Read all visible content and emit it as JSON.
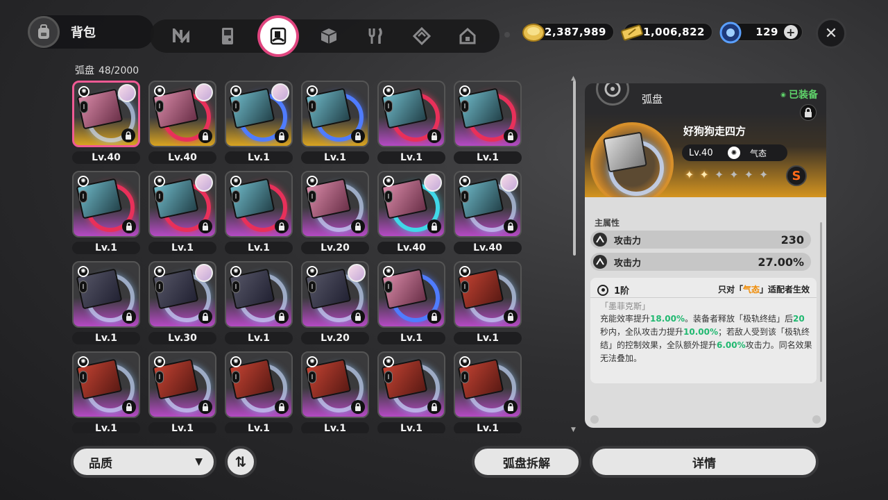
{
  "header": {
    "title": "背包",
    "tabs": [
      "n-icon",
      "gameboy-icon",
      "disk-icon",
      "cube-icon",
      "utensils-icon",
      "gem-icon",
      "home-icon"
    ],
    "active_tab_index": 2
  },
  "currencies": [
    {
      "icon": "coin-icon",
      "value": "2,387,989",
      "color": "#e8c050"
    },
    {
      "icon": "ticket-icon",
      "value": "1,006,822",
      "color": "#f0c858"
    },
    {
      "icon": "polychrome-icon",
      "value": "129",
      "color": "#5aa0ff"
    }
  ],
  "inventory": {
    "label": "弧盘",
    "count": "48/2000"
  },
  "items": [
    {
      "level": "Lv.40",
      "quality": "gold",
      "ring": "white",
      "art": "pink",
      "avatar": true,
      "selected": true
    },
    {
      "level": "Lv.40",
      "quality": "gold",
      "ring": "red",
      "art": "pink",
      "avatar": true
    },
    {
      "level": "Lv.1",
      "quality": "gold",
      "ring": "blue",
      "art": "teal",
      "avatar": true
    },
    {
      "level": "Lv.1",
      "quality": "gold",
      "ring": "blue",
      "art": "teal",
      "avatar": false
    },
    {
      "level": "Lv.1",
      "quality": "purple",
      "ring": "red",
      "art": "teal",
      "avatar": false
    },
    {
      "level": "Lv.1",
      "quality": "purple",
      "ring": "red",
      "art": "teal",
      "avatar": false
    },
    {
      "level": "Lv.1",
      "quality": "purple",
      "ring": "red",
      "art": "teal",
      "avatar": false
    },
    {
      "level": "Lv.1",
      "quality": "purple",
      "ring": "red",
      "art": "teal",
      "avatar": true
    },
    {
      "level": "Lv.1",
      "quality": "purple",
      "ring": "red",
      "art": "teal",
      "avatar": false
    },
    {
      "level": "Lv.20",
      "quality": "purple",
      "ring": "white",
      "art": "pink",
      "avatar": false
    },
    {
      "level": "Lv.40",
      "quality": "purple",
      "ring": "cyan",
      "art": "pink",
      "avatar": true
    },
    {
      "level": "Lv.40",
      "quality": "purple",
      "ring": "white",
      "art": "teal",
      "avatar": true
    },
    {
      "level": "Lv.1",
      "quality": "purple",
      "ring": "white",
      "art": "none",
      "avatar": false
    },
    {
      "level": "Lv.30",
      "quality": "purple",
      "ring": "white",
      "art": "none",
      "avatar": true
    },
    {
      "level": "Lv.1",
      "quality": "purple",
      "ring": "white",
      "art": "none",
      "avatar": false
    },
    {
      "level": "Lv.20",
      "quality": "purple",
      "ring": "white",
      "art": "none",
      "avatar": true
    },
    {
      "level": "Lv.1",
      "quality": "purple",
      "ring": "blue",
      "art": "pink",
      "avatar": false
    },
    {
      "level": "Lv.1",
      "quality": "purple",
      "ring": "white",
      "art": "red",
      "avatar": false
    },
    {
      "level": "Lv.1",
      "quality": "purple",
      "ring": "white",
      "art": "red",
      "avatar": false
    },
    {
      "level": "Lv.1",
      "quality": "purple",
      "ring": "white",
      "art": "red",
      "avatar": false
    },
    {
      "level": "Lv.1",
      "quality": "purple",
      "ring": "white",
      "art": "red",
      "avatar": false
    },
    {
      "level": "Lv.1",
      "quality": "purple",
      "ring": "white",
      "art": "red",
      "avatar": false
    },
    {
      "level": "Lv.1",
      "quality": "purple",
      "ring": "white",
      "art": "red",
      "avatar": false
    },
    {
      "level": "Lv.1",
      "quality": "purple",
      "ring": "white",
      "art": "red",
      "avatar": false
    }
  ],
  "rank_label": "I",
  "detail": {
    "category": "弧盘",
    "equipped_label": "已装备",
    "name": "好狗狗走四方",
    "level": "Lv.40",
    "attribute": "气态",
    "stars_total": 6,
    "stars_on": 2,
    "rank": "S",
    "main_stats_label": "主属性",
    "stats": [
      {
        "name": "攻击力",
        "value": "230"
      },
      {
        "name": "攻击力",
        "value": "27.00%"
      }
    ],
    "set": {
      "tier": "1阶",
      "condition_prefix": "只对「",
      "condition_highlight": "气态",
      "condition_suffix": "」适配者生效",
      "set_name": "「墨菲克斯」",
      "desc_parts": [
        {
          "t": "充能效率提升",
          "g": false
        },
        {
          "t": "18.00%",
          "g": true
        },
        {
          "t": "。装备者释放「极轨终结」后",
          "g": false
        },
        {
          "t": "20",
          "g": true
        },
        {
          "t": "秒内，全队攻击力提升",
          "g": false
        },
        {
          "t": "10.00%",
          "g": true
        },
        {
          "t": "；若敌人受到该「极轨终结」的控制效果，全队额外提升",
          "g": false
        },
        {
          "t": "6.00%",
          "g": true
        },
        {
          "t": "攻击力。同名效果无法叠加。",
          "g": false
        }
      ]
    }
  },
  "buttons": {
    "quality": "品质",
    "dismantle": "弧盘拆解",
    "details": "详情"
  }
}
